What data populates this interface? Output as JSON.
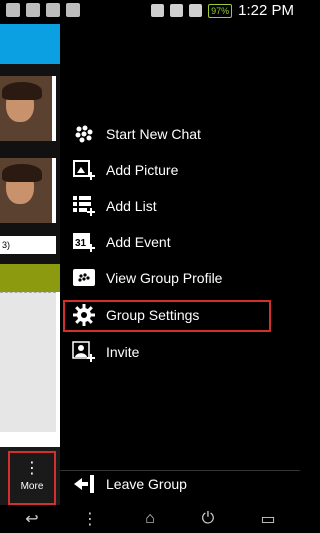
{
  "status_bar": {
    "battery": "97%",
    "time": "1:22 PM"
  },
  "background_app": {
    "caption_fragment": "3)",
    "more_button_label": "More"
  },
  "menu": {
    "items": [
      {
        "label": "Start New Chat",
        "icon": "bbm-chat-icon"
      },
      {
        "label": "Add Picture",
        "icon": "add-picture-icon"
      },
      {
        "label": "Add List",
        "icon": "add-list-icon"
      },
      {
        "label": "Add Event",
        "icon": "add-event-icon"
      },
      {
        "label": "View Group Profile",
        "icon": "group-profile-icon"
      },
      {
        "label": "Group Settings",
        "icon": "gear-icon"
      },
      {
        "label": "Invite",
        "icon": "invite-icon"
      }
    ],
    "footer_item": {
      "label": "Leave Group",
      "icon": "leave-group-icon"
    }
  },
  "colors": {
    "highlight": "#d32f2f",
    "header_blue": "#0aa0e2",
    "battery_green": "#9acd32"
  },
  "nav_bar": [
    "back-icon",
    "menu-icon",
    "home-icon",
    "power-icon",
    "recent-apps-icon"
  ]
}
